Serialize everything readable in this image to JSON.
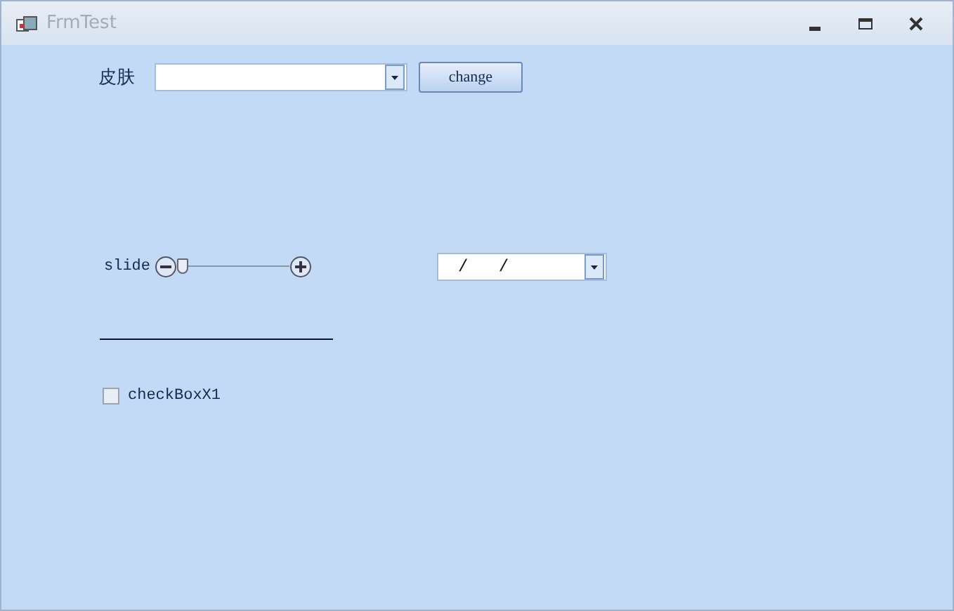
{
  "window": {
    "title": "FrmTest"
  },
  "skin": {
    "label": "皮肤"
  },
  "change_button": {
    "label": "change"
  },
  "slider": {
    "label": "slide",
    "level": 0
  },
  "date_field": {
    "value": "/   /"
  },
  "checkbox": {
    "label": "checkBoxX1",
    "checked": false
  }
}
